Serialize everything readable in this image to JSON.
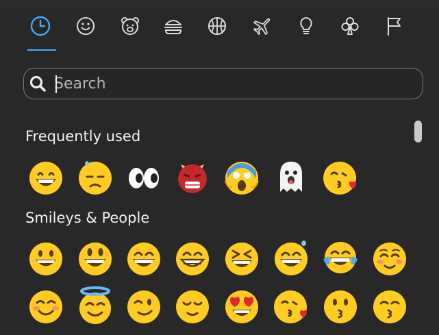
{
  "tabs": [
    {
      "name": "tab-recent",
      "icon": "clock-icon",
      "active": true
    },
    {
      "name": "tab-smileys",
      "icon": "smiley-icon"
    },
    {
      "name": "tab-animals",
      "icon": "bear-icon"
    },
    {
      "name": "tab-food",
      "icon": "burger-icon"
    },
    {
      "name": "tab-activities",
      "icon": "ball-icon"
    },
    {
      "name": "tab-travel",
      "icon": "airplane-icon"
    },
    {
      "name": "tab-objects",
      "icon": "lightbulb-icon"
    },
    {
      "name": "tab-symbols",
      "icon": "club-icon"
    },
    {
      "name": "tab-flags",
      "icon": "flag-icon"
    }
  ],
  "search": {
    "placeholder": "Search",
    "value": ""
  },
  "sections": {
    "frequent": {
      "label": "Frequently used"
    },
    "smileys": {
      "label": "Smileys & People"
    }
  },
  "emojis": {
    "frequent": [
      "grinning-face",
      "downcast-sweat-face",
      "eyes",
      "ogre",
      "screaming-fear-face",
      "ghost",
      "face-blowing-kiss"
    ],
    "smileys_row1": [
      "grinning-face",
      "grinning-big-eyes",
      "grinning-smiling-eyes",
      "beaming-face",
      "squinting-face",
      "grinning-sweat",
      "tears-of-joy",
      "smiling-blush"
    ],
    "smileys_row2": [
      "smiling-face",
      "halo-face",
      "winking-face",
      "relieved-face",
      "heart-eyes",
      "face-blowing-kiss",
      "kissing-face",
      "kissing-smiling-eyes"
    ]
  },
  "colors": {
    "background": "#282828",
    "accent": "#4ba8ff",
    "emoji_yellow": "#ffcc22",
    "text": "#f2f2f2"
  }
}
